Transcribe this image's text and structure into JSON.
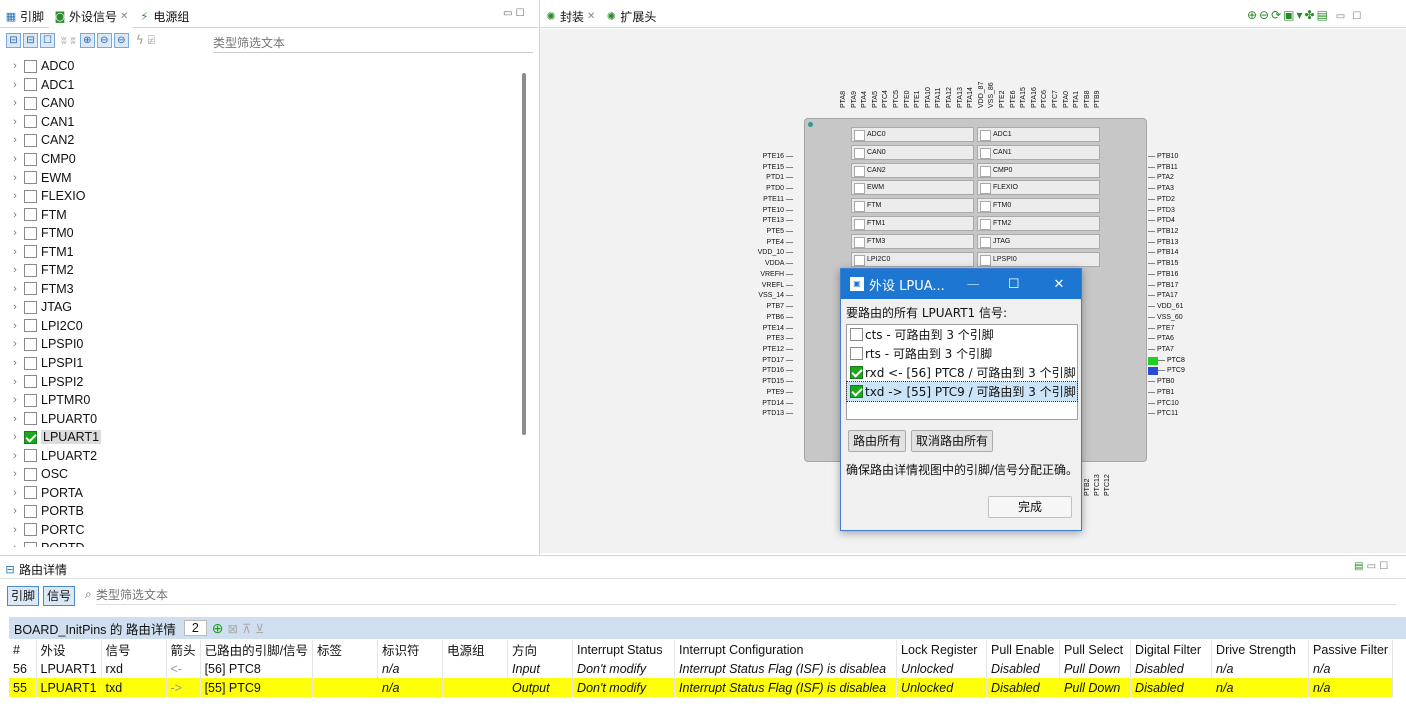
{
  "left_tabs": [
    {
      "label": "引脚"
    },
    {
      "label": "外设信号"
    },
    {
      "label": "电源组"
    }
  ],
  "right_tabs": [
    {
      "label": "封装"
    },
    {
      "label": "扩展头"
    }
  ],
  "left_filter_placeholder": "类型筛选文本",
  "tree": [
    {
      "label": "ADC0",
      "checked": false
    },
    {
      "label": "ADC1",
      "checked": false
    },
    {
      "label": "CAN0",
      "checked": false
    },
    {
      "label": "CAN1",
      "checked": false
    },
    {
      "label": "CAN2",
      "checked": false
    },
    {
      "label": "CMP0",
      "checked": false
    },
    {
      "label": "EWM",
      "checked": false
    },
    {
      "label": "FLEXIO",
      "checked": false
    },
    {
      "label": "FTM",
      "checked": false
    },
    {
      "label": "FTM0",
      "checked": false
    },
    {
      "label": "FTM1",
      "checked": false
    },
    {
      "label": "FTM2",
      "checked": false
    },
    {
      "label": "FTM3",
      "checked": false
    },
    {
      "label": "JTAG",
      "checked": false
    },
    {
      "label": "LPI2C0",
      "checked": false
    },
    {
      "label": "LPSPI0",
      "checked": false
    },
    {
      "label": "LPSPI1",
      "checked": false
    },
    {
      "label": "LPSPI2",
      "checked": false
    },
    {
      "label": "LPTMR0",
      "checked": false
    },
    {
      "label": "LPUART0",
      "checked": false
    },
    {
      "label": "LPUART1",
      "checked": true,
      "selected": true
    },
    {
      "label": "LPUART2",
      "checked": false
    },
    {
      "label": "OSC",
      "checked": false
    },
    {
      "label": "PORTA",
      "checked": false
    },
    {
      "label": "PORTB",
      "checked": false
    },
    {
      "label": "PORTC",
      "checked": false
    },
    {
      "label": "PORTD",
      "checked": false
    }
  ],
  "pkg_cells": [
    [
      "ADC0",
      "ADC1"
    ],
    [
      "CAN0",
      "CAN1"
    ],
    [
      "CAN2",
      "CMP0"
    ],
    [
      "EWM",
      "FLEXIO"
    ],
    [
      "FTM",
      "FTM0"
    ],
    [
      "FTM1",
      "FTM2"
    ],
    [
      "FTM3",
      "JTAG"
    ],
    [
      "LPI2C0",
      "LPSPI0"
    ]
  ],
  "pins_left": [
    "PTE16",
    "PTE15",
    "PTD1",
    "PTD0",
    "PTE11",
    "PTE10",
    "PTE13",
    "PTE5",
    "PTE4",
    "VDD_10",
    "VDDA",
    "VREFH",
    "VREFL",
    "VSS_14",
    "PTB7",
    "PTB6",
    "PTE14",
    "PTE3",
    "PTE12",
    "PTD17",
    "PTD16",
    "PTD15",
    "PTE9",
    "PTD14",
    "PTD13"
  ],
  "pins_right": [
    "PTB10",
    "PTB11",
    "PTA2",
    "PTA3",
    "PTD2",
    "PTD3",
    "PTD4",
    "PTB12",
    "PTB13",
    "PTB14",
    "PTB15",
    "PTB16",
    "PTB17",
    "PTA17",
    "VDD_61",
    "VSS_60",
    "PTE7",
    "PTA6",
    "PTA7",
    "PTC8",
    "PTC9",
    "PTB0",
    "PTB1",
    "PTC10",
    "PTC11"
  ],
  "pins_top": [
    "PTA8",
    "PTA9",
    "PTA4",
    "PTA5",
    "PTC4",
    "PTC5",
    "PTE0",
    "PTE1",
    "PTA10",
    "PTA11",
    "PTA12",
    "PTA13",
    "PTA14",
    "VDD_87",
    "VSS_86",
    "PTE2",
    "PTE6",
    "PTA15",
    "PTA16",
    "PTC6",
    "PTC7",
    "PTA0",
    "PTA1",
    "PTB8",
    "PTB9"
  ],
  "pins_bottom": [
    "PTB2",
    "PTC13",
    "PTC12"
  ],
  "dialog": {
    "title": "外设 LPUA...",
    "prompt": "要路由的所有 LPUART1 信号:",
    "items": [
      {
        "label": "cts - 可路由到 3 个引脚",
        "checked": false
      },
      {
        "label": "rts - 可路由到 3 个引脚",
        "checked": false
      },
      {
        "label": "rxd <- [56] PTC8 / 可路由到 3 个引脚",
        "checked": true
      },
      {
        "label": "txd -> [55] PTC9 / 可路由到 3 个引脚",
        "checked": true,
        "selected": true
      }
    ],
    "route_all": "路由所有",
    "unroute_all": "取消路由所有",
    "note": "确保路由详情视图中的引脚/信号分配正确。",
    "done": "完成"
  },
  "routing": {
    "tab_label": "路由详情",
    "btn_pins": "引脚",
    "btn_signals": "信号",
    "filter_placeholder": "类型筛选文本",
    "header_title": "BOARD_InitPins 的 路由详情",
    "count": "2",
    "columns": [
      "#",
      "外设",
      "信号",
      "箭头",
      "已路由的引脚/信号",
      "标签",
      "标识符",
      "电源组",
      "方向",
      "Interrupt Status",
      "Interrupt Configuration",
      "Lock Register",
      "Pull Enable",
      "Pull Select",
      "Digital Filter",
      "Drive Strength",
      "Passive Filter"
    ],
    "rows": [
      [
        "56",
        "LPUART1",
        "rxd",
        "<-",
        "[56] PTC8",
        "",
        "n/a",
        "",
        "Input",
        "Don't modify",
        "Interrupt Status Flag (ISF) is disablea",
        "Unlocked",
        "Disabled",
        "Pull Down",
        "Disabled",
        "n/a",
        "n/a"
      ],
      [
        "55",
        "LPUART1",
        "txd",
        "->",
        "[55] PTC9",
        "",
        "n/a",
        "",
        "Output",
        "Don't modify",
        "Interrupt Status Flag (ISF) is disablea",
        "Unlocked",
        "Disabled",
        "Pull Down",
        "Disabled",
        "n/a",
        "n/a"
      ]
    ]
  }
}
